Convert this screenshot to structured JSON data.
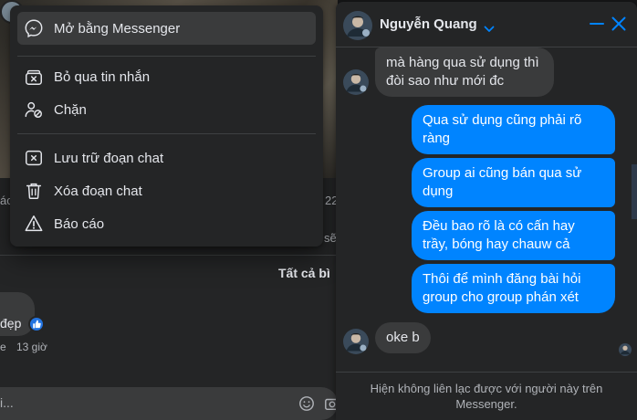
{
  "background": {
    "left_partial": "ác",
    "time_partial": "22",
    "xem_partial": "sẽ",
    "filter_label": "Tất cả bì",
    "comment_text": "đẹp",
    "comment_meta_e": "e",
    "comment_time": "13 giờ",
    "comment_placeholder": "i..."
  },
  "context_menu": {
    "items": [
      {
        "label": "Mở bằng Messenger",
        "icon": "messenger-icon",
        "active": true
      },
      {
        "label": "Bỏ qua tin nhắn",
        "icon": "ignore-messages-icon"
      },
      {
        "label": "Chặn",
        "icon": "block-user-icon"
      },
      {
        "label": "Lưu trữ đoạn chat",
        "icon": "archive-icon"
      },
      {
        "label": "Xóa đoạn chat",
        "icon": "trash-icon"
      },
      {
        "label": "Báo cáo",
        "icon": "warning-icon"
      }
    ]
  },
  "chat": {
    "contact_name": "Nguyễn Quang",
    "accent_color": "#0084ff",
    "messages": [
      {
        "from": "them",
        "text": "mà hàng qua sử dụng thì\nđòi sao như mới đc"
      },
      {
        "from": "me",
        "text": "Qua sử dụng cũng phải rõ\nràng"
      },
      {
        "from": "me",
        "text": "Group ai cũng bán qua sử\ndụng"
      },
      {
        "from": "me",
        "text": "Đều bao rõ là có cấn hay\ntrầy, bóng hay chauw cả"
      },
      {
        "from": "me",
        "text": "Thôi để mình đăng bài hỏi\ngroup cho group phán xét"
      },
      {
        "from": "them",
        "text": "oke b"
      }
    ],
    "footer_notice": "Hiện không liên lạc được với người này trên Messenger."
  }
}
